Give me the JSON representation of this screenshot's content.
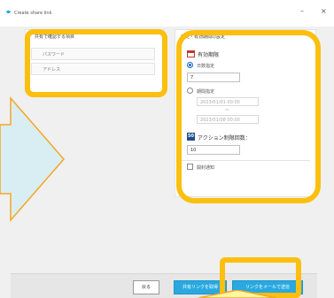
{
  "window": {
    "title": "Create share link",
    "minimize_glyph": "–",
    "close_glyph": "×"
  },
  "left_panel": {
    "heading": "共有で確認する項目",
    "items": [
      {
        "label": "パスワード"
      },
      {
        "label": "アドレス"
      }
    ]
  },
  "right_panel": {
    "heading": "設定・有効期間の設定",
    "expiration": {
      "icon": "calendar-icon",
      "title": "有効期限",
      "option_days_label": "日数指定",
      "days_value": "7",
      "option_date_label": "期間指定",
      "date_start_placeholder": "2023/01/01 00:00",
      "date_separator": "～",
      "date_end_placeholder": "2023/01/08 00:00",
      "selected": "days"
    },
    "actions": {
      "badge": "50",
      "title": "アクション制限回数：",
      "value": "10"
    },
    "notify": {
      "label": "開封通知",
      "checked": false
    }
  },
  "footer": {
    "back_label": "戻る",
    "copy_link_label": "共有リンクを取得",
    "send_mail_label": "リンクをメールで送信"
  },
  "annotation": {
    "highlight_color": "#fbbf0f",
    "arrow_fill": "#d9eef2",
    "arrow_stroke": "#f5a623"
  },
  "colors": {
    "primary_button": "#29a9e0",
    "badge": "#1f4e8c",
    "calendar_accent": "#c0392b"
  }
}
